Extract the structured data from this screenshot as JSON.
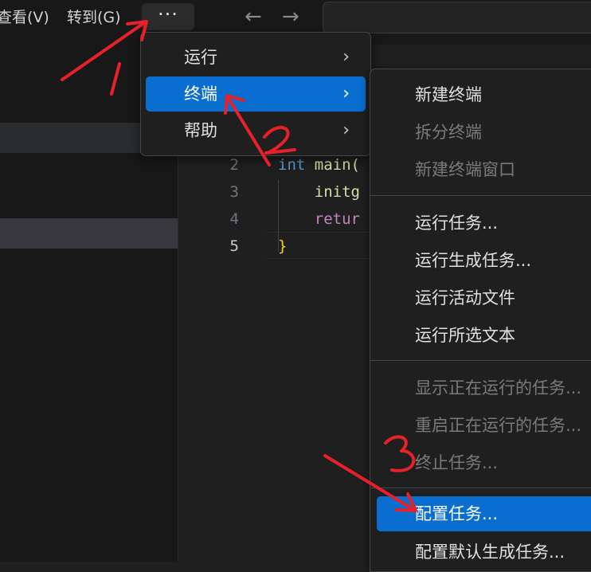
{
  "menubar": {
    "view": "查看(V)",
    "goto": "转到(G)",
    "more": "···"
  },
  "nav": {
    "back": "←",
    "forward": "→"
  },
  "editor": {
    "lines": [
      {
        "num": "2",
        "kw": "int",
        "rest": " main("
      },
      {
        "num": "3",
        "text": "    initg"
      },
      {
        "num": "4",
        "ctl": "    retur"
      },
      {
        "num": "5",
        "brace": "}"
      }
    ]
  },
  "menu1": {
    "items": [
      {
        "label": "运行",
        "chevron": "›"
      },
      {
        "label": "终端",
        "chevron": "›"
      },
      {
        "label": "帮助",
        "chevron": "›"
      }
    ]
  },
  "menu2": {
    "items": [
      "新建终端",
      "拆分终端",
      "新建终端窗口",
      "运行任务...",
      "运行生成任务...",
      "运行活动文件",
      "运行所选文本",
      "显示正在运行的任务...",
      "重启正在运行的任务...",
      "终止任务...",
      "配置任务...",
      "配置默认生成任务..."
    ]
  },
  "annotations": {
    "one": "1",
    "two": "2",
    "three": "3"
  },
  "colors": {
    "selection": "#0a6ed1",
    "annotation": "#e8202a",
    "keyword": "#569cd6"
  }
}
